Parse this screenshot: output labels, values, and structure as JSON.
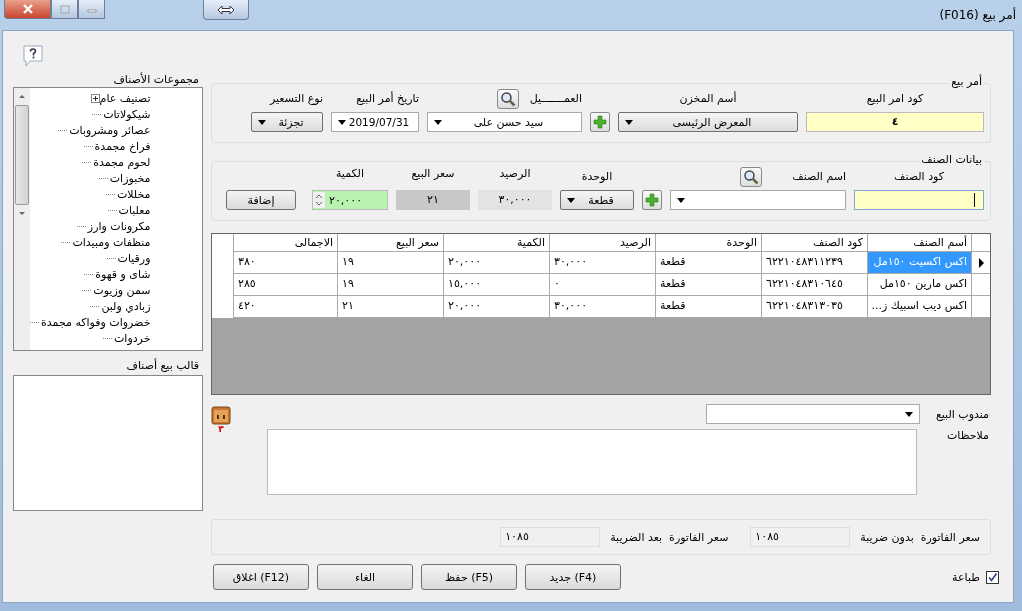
{
  "window": {
    "title": "(F016) أمر بيع"
  },
  "groups_panel": {
    "title": "مجموعات الأصناف",
    "items": [
      {
        "label": "تصنيف عام",
        "kind": "group"
      },
      {
        "label": "شيكولاتات",
        "kind": "leaf"
      },
      {
        "label": "عصائر ومشروبات",
        "kind": "leaf"
      },
      {
        "label": "فراخ مجمدة",
        "kind": "leaf"
      },
      {
        "label": "لحوم مجمدة",
        "kind": "leaf"
      },
      {
        "label": "مخبوزات",
        "kind": "leaf"
      },
      {
        "label": "مخللات",
        "kind": "leaf"
      },
      {
        "label": "معلبات",
        "kind": "leaf"
      },
      {
        "label": "مكرونات وارز",
        "kind": "leaf"
      },
      {
        "label": "منظفات ومبيدات",
        "kind": "leaf"
      },
      {
        "label": "ورقيات",
        "kind": "leaf"
      },
      {
        "label": "شاى و قهوة",
        "kind": "leaf"
      },
      {
        "label": "سمن وزيوت",
        "kind": "leaf"
      },
      {
        "label": "زبادي ولبن",
        "kind": "leaf"
      },
      {
        "label": "خضروات وفواكه مجمدة",
        "kind": "leaf"
      },
      {
        "label": "خردوات",
        "kind": "leaf"
      }
    ]
  },
  "template_panel": {
    "title": "قالب بيع أصناف"
  },
  "order": {
    "title": "أمر بيع",
    "code": {
      "label": "كود امر البيع",
      "value": "٤"
    },
    "warehouse": {
      "label": "أسم المخزن",
      "value": "المعرض الرئيسى"
    },
    "client": {
      "label": "العمـــــــيل",
      "value": "سيد حسن على"
    },
    "date": {
      "label": "تاريخ أمر البيع",
      "value": "2019/07/31"
    },
    "pricing": {
      "label": "نوع التسعير",
      "value": "تجزئة"
    }
  },
  "item_data": {
    "title": "بيانات الصنف",
    "code": {
      "label": "كود الصنف"
    },
    "name": {
      "label": "اسم الصنف"
    },
    "unit": {
      "label": "الوحدة",
      "value": "قطعة"
    },
    "balance": {
      "label": "الرصيد",
      "value": "٣٠,٠٠٠"
    },
    "price": {
      "label": "سعر البيع",
      "value": "٢١"
    },
    "quantity": {
      "label": "الكمية",
      "value": "٢٠,٠٠٠"
    },
    "add_button": "إضافة"
  },
  "table": {
    "columns": [
      "أسم الصنف",
      "كود الصنف",
      "الوحدة",
      "الرصيد",
      "الكمية",
      "سعر البيع",
      "الاجمالى"
    ],
    "rows": [
      {
        "selected": true,
        "cells": [
          "اكس اكسيت ١٥٠مل",
          "٦٢٢١٠٤٨٣١١٢٣٩",
          "قطعة",
          "٣٠,٠٠٠",
          "٢٠,٠٠٠",
          "١٩",
          "٣٨٠"
        ]
      },
      {
        "selected": false,
        "cells": [
          "اكس مارين ١٥٠مل",
          "٦٢٢١٠٤٨٣١٠٦٤٥",
          "قطعة",
          "٠",
          "١٥,٠٠٠",
          "١٩",
          "٢٨٥"
        ]
      },
      {
        "selected": false,
        "cells": [
          "اكس ديب اسبيك ز...",
          "٦٢٢١٠٤٨٣١٣٠٣٥",
          "قطعة",
          "٣٠,٠٠٠",
          "٢٠,٠٠٠",
          "٢١",
          "٤٢٠"
        ]
      }
    ]
  },
  "sales_rep": {
    "label": "مندوب البيع"
  },
  "attachments": {
    "count": "٣"
  },
  "notes": {
    "label": "ملاحظات"
  },
  "totals": {
    "before_tax": {
      "label": "سعر الفاتورة  بدون ضريبة",
      "value": "١٠٨٥"
    },
    "after_tax": {
      "label": "سعر الفاتورة  بعد الضريبة",
      "value": "١٠٨٥"
    }
  },
  "print": {
    "label": "طباعة",
    "checked": true
  },
  "buttons": [
    "جديد (F4)",
    "حفظ (F5)",
    "الغاء",
    "اغلاق (F12)"
  ]
}
